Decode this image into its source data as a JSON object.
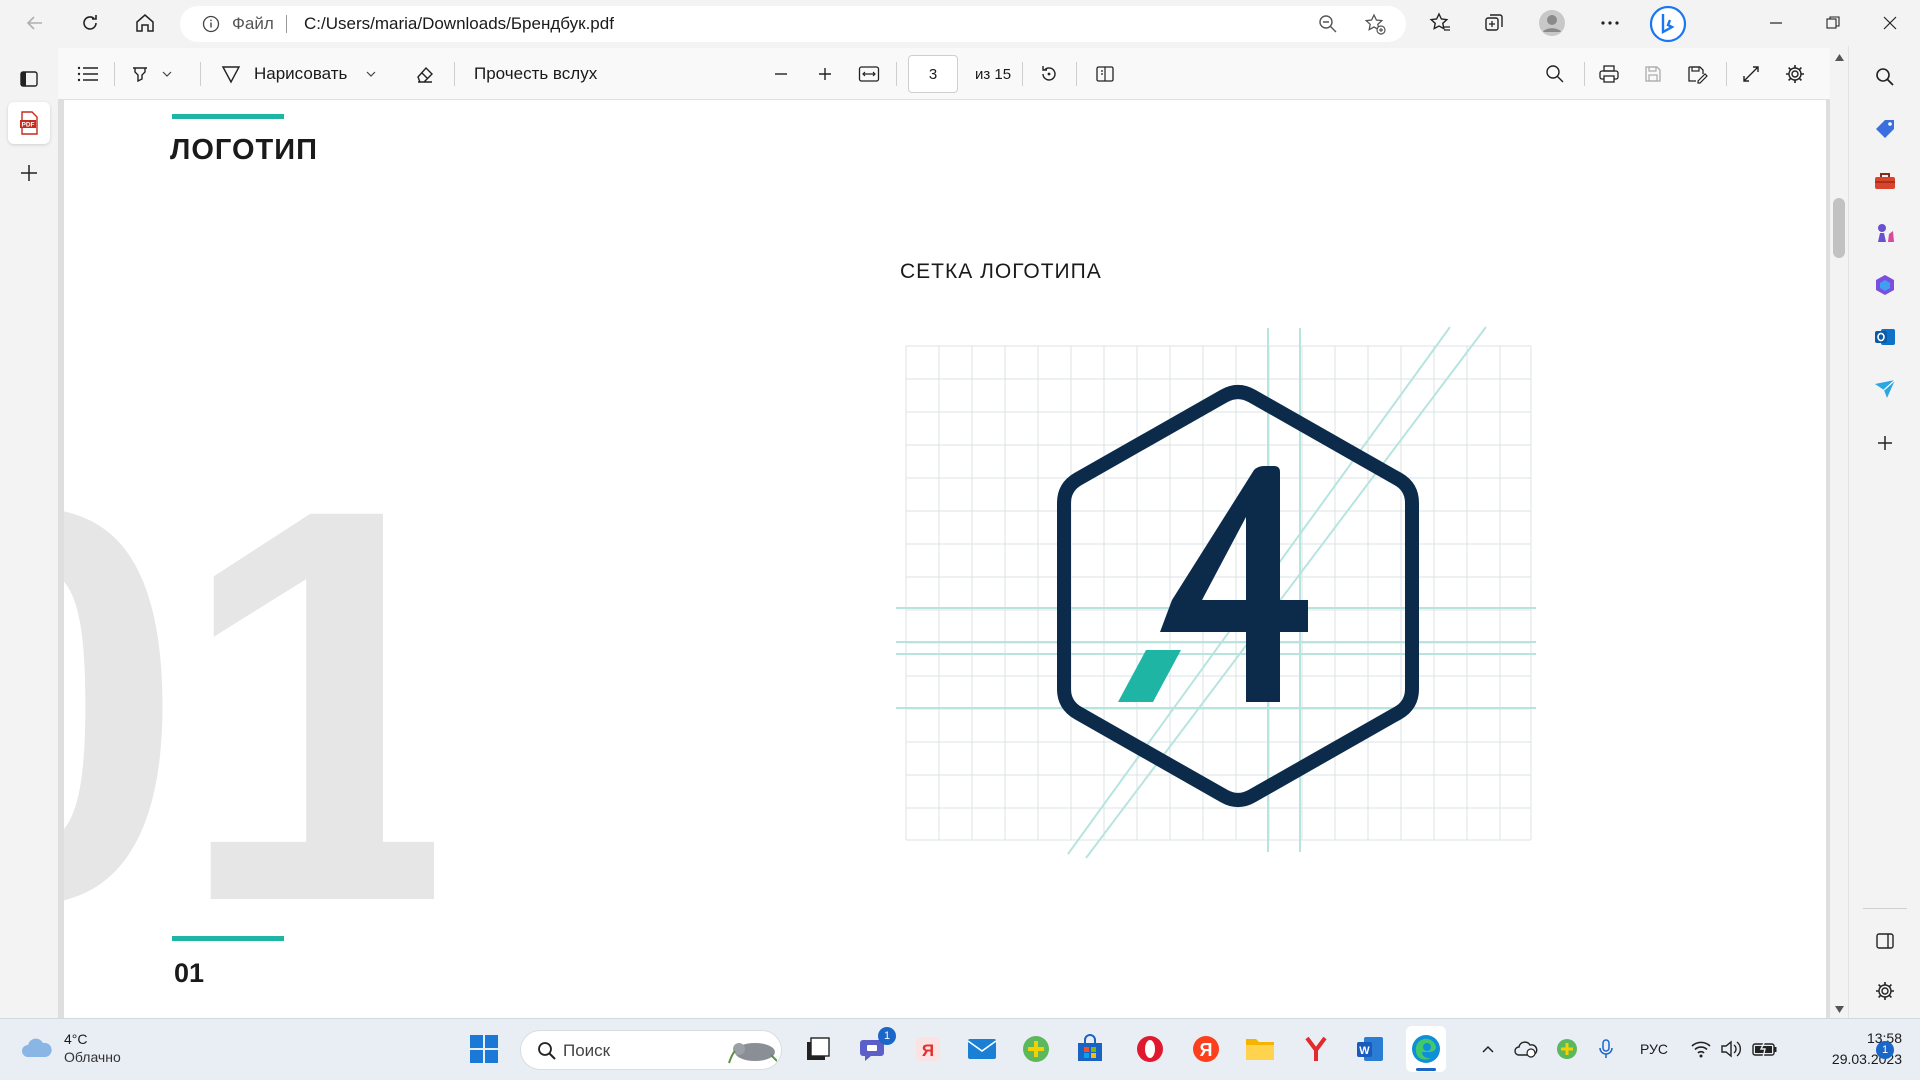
{
  "browser": {
    "address": {
      "scheme_label": "Файл",
      "url": "C:/Users/maria/Downloads/Брендбук.pdf"
    }
  },
  "pdf_toolbar": {
    "draw_label": "Нарисовать",
    "read_aloud_label": "Прочесть вслух",
    "page_current": "3",
    "page_total_label": "из 15"
  },
  "page": {
    "section_title": "ЛОГОТИП",
    "big_number": "01",
    "grid_title": "СЕТКА ЛОГОТИПА",
    "logo_glyph": "4",
    "footer_number": "01",
    "accent_color": "#1fb5a5",
    "logo_color": "#0c2a4a"
  },
  "taskbar": {
    "weather_temp": "4°C",
    "weather_desc": "Облачно",
    "search_placeholder": "Поиск",
    "chat_badge": "1",
    "yandex_label": "Я",
    "lang": "РУС",
    "time": "13:58",
    "date": "29.03.2023",
    "notification_count": "1"
  }
}
